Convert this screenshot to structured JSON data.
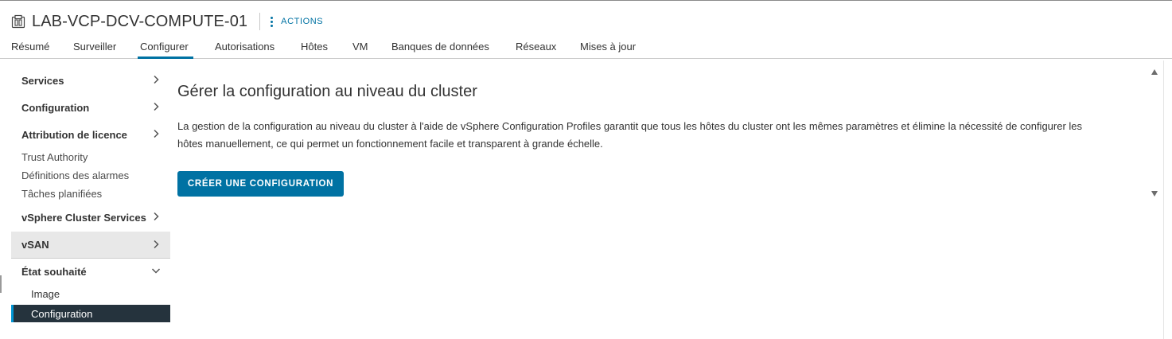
{
  "header": {
    "title": "LAB-VCP-DCV-COMPUTE-01",
    "title_icon": "cluster-icon",
    "actions_icon": "kebab-vertical-icon",
    "actions_label": "ACTIONS"
  },
  "tabs": [
    {
      "label": "Résumé"
    },
    {
      "label": "Surveiller"
    },
    {
      "label": "Configurer",
      "active": true
    },
    {
      "label": "Autorisations"
    },
    {
      "label": "Hôtes"
    },
    {
      "label": "VM"
    },
    {
      "label": "Banques de données"
    },
    {
      "label": "Réseaux"
    },
    {
      "label": "Mises à jour"
    }
  ],
  "sidebar": {
    "services": "Services",
    "configuration": "Configuration",
    "licensing": "Attribution de licence",
    "trust_authority": "Trust Authority",
    "alarm_definitions": "Définitions des alarmes",
    "scheduled_tasks": "Tâches planifiées",
    "vsphere_cluster_services": "vSphere Cluster Services",
    "vsan": "vSAN",
    "desired_state": "État souhaité",
    "image": "Image",
    "desired_configuration": "Configuration"
  },
  "main": {
    "heading": "Gérer la configuration au niveau du cluster",
    "description_line1": "La gestion de la configuration au niveau du cluster à l'aide de vSphere Configuration Profiles garantit que tous les hôtes du cluster ont les mêmes paramètres et élimine la nécessité de configurer les",
    "description_line2": "hôtes manuellement, ce qui permet un fonctionnement facile et transparent à grande échelle.",
    "create_button": "CRÉER UNE CONFIGURATION"
  },
  "colors": {
    "accent": "#0072a3",
    "active_nav_bg": "#25333d",
    "active_nav_marker": "#0095d3",
    "selected_group_bg": "#e8e8e8"
  }
}
